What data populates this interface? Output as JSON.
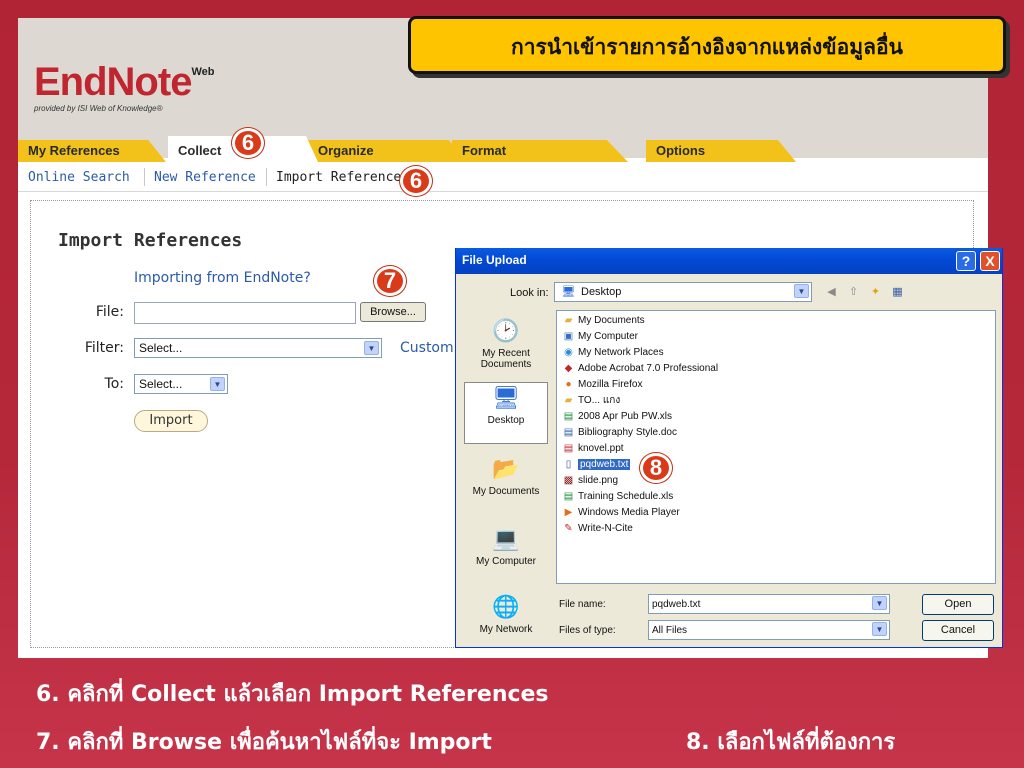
{
  "banner": {
    "title": "การนำเข้ารายการอ้างอิงจากแหล่งข้อมูลอื่น"
  },
  "logo": {
    "main": "EndNote",
    "superscript": "Web",
    "tagline": "provided by ISI Web of Knowledge®"
  },
  "tabs": [
    {
      "label": "My References"
    },
    {
      "label": "Collect"
    },
    {
      "label": "Organize"
    },
    {
      "label": "Format"
    },
    {
      "label": "Options"
    }
  ],
  "subnav": {
    "items": [
      "Online Search",
      "New Reference",
      "Import References"
    ]
  },
  "import_form": {
    "title": "Import References",
    "endnote_link": "Importing from EndNote?",
    "file_label": "File:",
    "file_value": "",
    "browse_label": "Browse...",
    "filter_label": "Filter:",
    "filter_value": "Select...",
    "custom_link": "Custom",
    "to_label": "To:",
    "to_value": "Select...",
    "import_label": "Import"
  },
  "badges": {
    "collect": "6",
    "import_refs": "6",
    "browse": "7",
    "file": "8"
  },
  "dialog": {
    "title": "File Upload",
    "help_label": "?",
    "close_label": "X",
    "look_in_label": "Look in:",
    "look_in_value": "Desktop",
    "places": [
      "My Recent Documents",
      "Desktop",
      "My Documents",
      "My Computer",
      "My Network"
    ],
    "files": [
      {
        "name": "My Documents",
        "icon": "folder-icon"
      },
      {
        "name": "My Computer",
        "icon": "computer-icon"
      },
      {
        "name": "My Network Places",
        "icon": "network-icon"
      },
      {
        "name": "Adobe Acrobat 7.0 Professional",
        "icon": "acrobat-icon"
      },
      {
        "name": "Mozilla Firefox",
        "icon": "firefox-icon"
      },
      {
        "name": "TO... แกง",
        "icon": "folder-icon"
      },
      {
        "name": "2008 Apr Pub PW.xls",
        "icon": "excel-icon"
      },
      {
        "name": "Bibliography Style.doc",
        "icon": "word-icon"
      },
      {
        "name": "knovel.ppt",
        "icon": "powerpoint-icon"
      },
      {
        "name": "pqdweb.txt",
        "icon": "text-file-icon",
        "selected": true
      },
      {
        "name": "slide.png",
        "icon": "png-icon"
      },
      {
        "name": "Training Schedule.xls",
        "icon": "excel-icon"
      },
      {
        "name": "Windows Media Player",
        "icon": "media-player-icon"
      },
      {
        "name": "Write-N-Cite",
        "icon": "write-n-cite-icon"
      }
    ],
    "file_name_label": "File name:",
    "file_name_value": "pqdweb.txt",
    "file_type_label": "Files of type:",
    "file_type_value": "All Files",
    "open_label": "Open",
    "cancel_label": "Cancel"
  },
  "instructions": {
    "step6": "6. คลิกที่ Collect แล้วเลือก Import References",
    "step7": "7. คลิกที่ Browse เพื่อค้นหาไฟล์ที่จะ Import",
    "step8": "8. เลือกไฟล์ที่ต้องการ"
  },
  "colors": {
    "slide_bg": "#b5283a",
    "banner": "#ffc400",
    "tab": "#f2c21a",
    "badge": "#d93a1a",
    "logo": "#c0262f",
    "link": "#2b5ba8"
  }
}
